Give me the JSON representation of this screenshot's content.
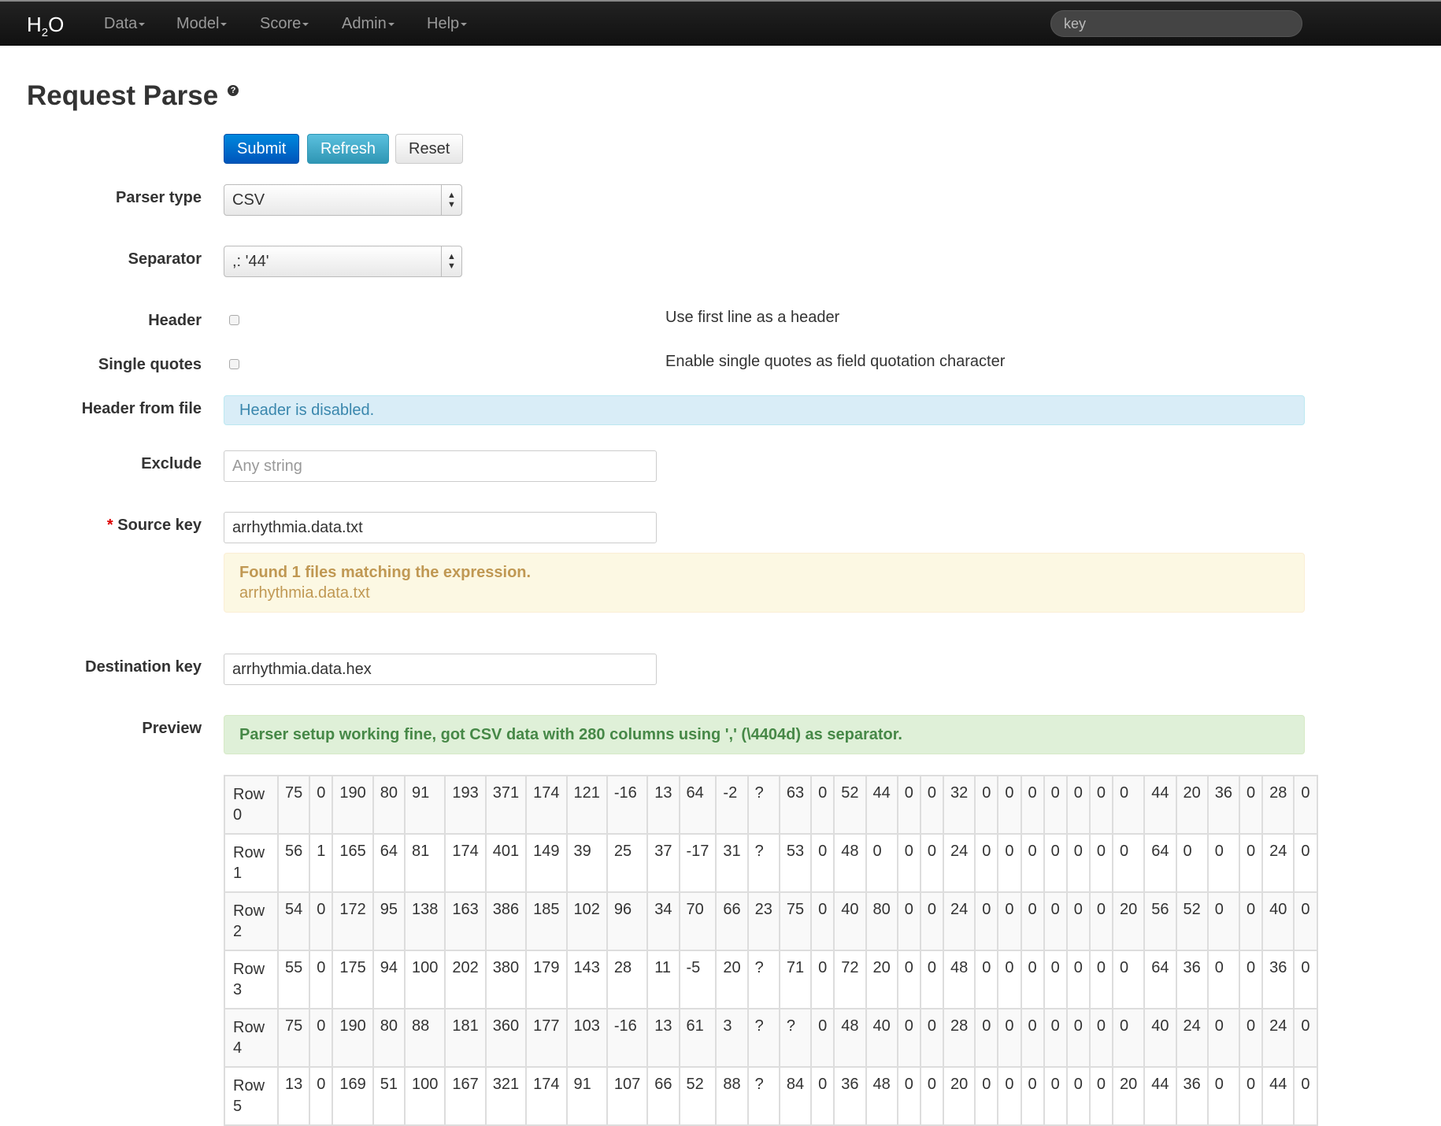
{
  "navbar": {
    "brand_h": "H",
    "brand_sub": "2",
    "brand_o": "O",
    "menus": [
      "Data",
      "Model",
      "Score",
      "Admin",
      "Help"
    ],
    "search_value": "key"
  },
  "page": {
    "title": "Request Parse",
    "help_icon": "question-circle-icon"
  },
  "buttons": {
    "submit": "Submit",
    "refresh": "Refresh",
    "reset": "Reset"
  },
  "form": {
    "parser_type": {
      "label": "Parser type",
      "value": "CSV"
    },
    "separator": {
      "label": "Separator",
      "value": ",: '44'"
    },
    "header": {
      "label": "Header",
      "checked": false,
      "help": "Use first line as a header"
    },
    "single_quotes": {
      "label": "Single quotes",
      "checked": false,
      "help": "Enable single quotes as field quotation character"
    },
    "header_from_file": {
      "label": "Header from file",
      "message": "Header is disabled."
    },
    "exclude": {
      "label": "Exclude",
      "value": "",
      "placeholder": "Any string"
    },
    "source_key": {
      "required_mark": "*",
      "label": "Source key",
      "value": "arrhythmia.data.txt",
      "match_title": "Found 1 files matching the expression.",
      "match_file": "arrhythmia.data.txt"
    },
    "destination_key": {
      "label": "Destination key",
      "value": "arrhythmia.data.hex"
    },
    "preview": {
      "label": "Preview",
      "message": "Parser setup working fine, got CSV data with 280 columns using ',' (\\4404d) as separator."
    }
  },
  "preview_table": {
    "rows": [
      {
        "label": "Row 0",
        "values": [
          "75",
          "0",
          "190",
          "80",
          "91",
          "193",
          "371",
          "174",
          "121",
          "-16",
          "13",
          "64",
          "-2",
          "?",
          "63",
          "0",
          "52",
          "44",
          "0",
          "0",
          "32",
          "0",
          "0",
          "0",
          "0",
          "0",
          "0",
          "0",
          "44",
          "20",
          "36",
          "0",
          "28",
          "0"
        ]
      },
      {
        "label": "Row 1",
        "values": [
          "56",
          "1",
          "165",
          "64",
          "81",
          "174",
          "401",
          "149",
          "39",
          "25",
          "37",
          "-17",
          "31",
          "?",
          "53",
          "0",
          "48",
          "0",
          "0",
          "0",
          "24",
          "0",
          "0",
          "0",
          "0",
          "0",
          "0",
          "0",
          "64",
          "0",
          "0",
          "0",
          "24",
          "0"
        ]
      },
      {
        "label": "Row 2",
        "values": [
          "54",
          "0",
          "172",
          "95",
          "138",
          "163",
          "386",
          "185",
          "102",
          "96",
          "34",
          "70",
          "66",
          "23",
          "75",
          "0",
          "40",
          "80",
          "0",
          "0",
          "24",
          "0",
          "0",
          "0",
          "0",
          "0",
          "0",
          "20",
          "56",
          "52",
          "0",
          "0",
          "40",
          "0"
        ]
      },
      {
        "label": "Row 3",
        "values": [
          "55",
          "0",
          "175",
          "94",
          "100",
          "202",
          "380",
          "179",
          "143",
          "28",
          "11",
          "-5",
          "20",
          "?",
          "71",
          "0",
          "72",
          "20",
          "0",
          "0",
          "48",
          "0",
          "0",
          "0",
          "0",
          "0",
          "0",
          "0",
          "64",
          "36",
          "0",
          "0",
          "36",
          "0"
        ]
      },
      {
        "label": "Row 4",
        "values": [
          "75",
          "0",
          "190",
          "80",
          "88",
          "181",
          "360",
          "177",
          "103",
          "-16",
          "13",
          "61",
          "3",
          "?",
          "?",
          "0",
          "48",
          "40",
          "0",
          "0",
          "28",
          "0",
          "0",
          "0",
          "0",
          "0",
          "0",
          "0",
          "40",
          "24",
          "0",
          "0",
          "24",
          "0"
        ]
      },
      {
        "label": "Row 5",
        "values": [
          "13",
          "0",
          "169",
          "51",
          "100",
          "167",
          "321",
          "174",
          "91",
          "107",
          "66",
          "52",
          "88",
          "?",
          "84",
          "0",
          "36",
          "48",
          "0",
          "0",
          "20",
          "0",
          "0",
          "0",
          "0",
          "0",
          "0",
          "20",
          "44",
          "36",
          "0",
          "0",
          "44",
          "0"
        ]
      }
    ]
  }
}
